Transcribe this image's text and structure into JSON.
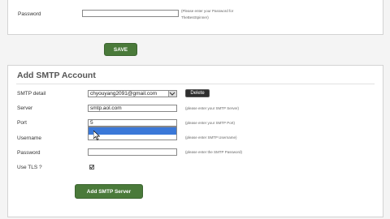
{
  "password_section": {
    "label": "Password",
    "value": "",
    "hint": "(Please enter your Password for TheBestSpinner)"
  },
  "save_button": "SAVE",
  "smtp_section": {
    "title": "Add SMTP Account",
    "detail_label": "SMTP detail",
    "detail_value": "chyouyang2091@gmail.com",
    "delete_button": "Delete",
    "server_label": "Server",
    "server_value": "smtp.aol.com",
    "server_hint": "(please enter your SMTP Server)",
    "port_label": "Port",
    "port_value": "5",
    "port_hint": "(please enter your SMTP Port)",
    "username_label": "Username",
    "username_value": "",
    "username_hint": "(please enter SMTP Username)",
    "password_label": "Password",
    "password_value": "",
    "password_hint": "(please enter the SMTP Password)",
    "tls_label": "Use TLS ?",
    "tls_checked": true,
    "add_button": "Add SMTP Server"
  },
  "icons": {
    "select_arrow": "chevron-down-icon",
    "cursor": "mouse-pointer-icon"
  },
  "colors": {
    "green_button": "#4a7a3a",
    "dark_button": "#2e2e2e",
    "dropdown_highlight": "#3a78d8"
  }
}
